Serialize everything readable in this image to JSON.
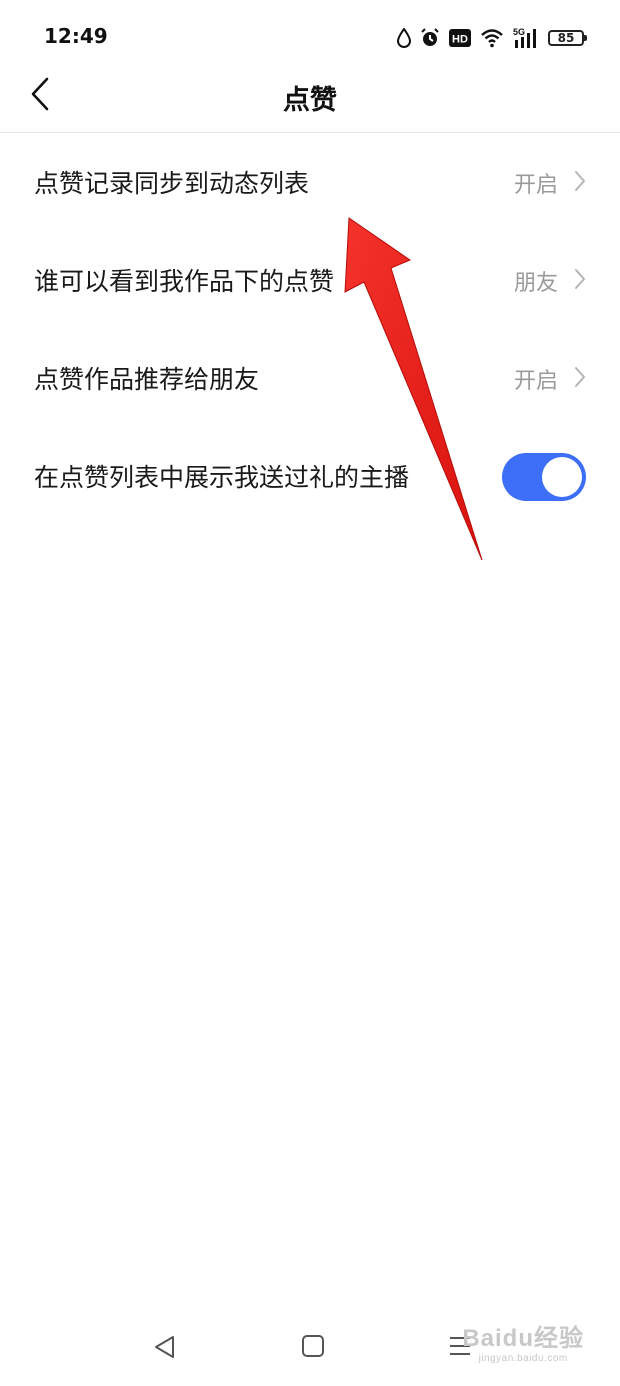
{
  "status_bar": {
    "time": "12:49",
    "network": "5G",
    "battery": "85",
    "hd_badge": "HD",
    "icons": [
      "water-drop-icon",
      "alarm-icon",
      "hd-icon",
      "wifi-icon",
      "signal-icon",
      "battery-icon"
    ]
  },
  "header": {
    "title": "点赞",
    "back_icon": "chevron-left-icon"
  },
  "settings": {
    "items": [
      {
        "label": "点赞记录同步到动态列表",
        "value": "开启",
        "control": "chevron"
      },
      {
        "label": "谁可以看到我作品下的点赞",
        "value": "朋友",
        "control": "chevron"
      },
      {
        "label": "点赞作品推荐给朋友",
        "value": "开启",
        "control": "chevron"
      },
      {
        "label": "在点赞列表中展示我送过礼的主播",
        "value": "",
        "control": "toggle",
        "toggle_on": true
      }
    ]
  },
  "colors": {
    "accent": "#3d6ef7",
    "annotation_arrow": "#e8201b",
    "secondary_text": "#9a9a9a",
    "divider": "#e6e6e6"
  },
  "system_nav": {
    "icons": [
      "back-triangle-icon",
      "home-square-icon",
      "menu-lines-icon"
    ]
  },
  "watermark": {
    "main": "Baidu经验",
    "sub": "jingyan.baidu.com"
  }
}
